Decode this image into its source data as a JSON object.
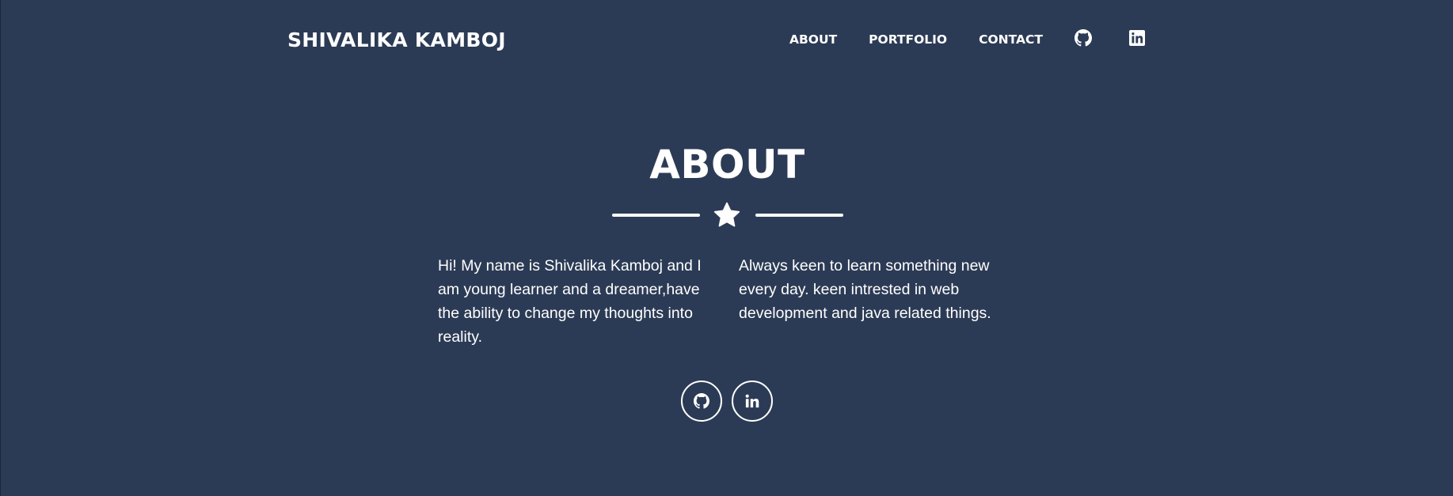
{
  "header": {
    "brand": "SHIVALIKA KAMBOJ",
    "nav": [
      {
        "label": "ABOUT"
      },
      {
        "label": "PORTFOLIO"
      },
      {
        "label": "CONTACT"
      }
    ],
    "icons": [
      "github-icon",
      "linkedin-icon"
    ]
  },
  "about": {
    "title": "ABOUT",
    "divider_icon": "star-icon",
    "paragraph_left": "Hi! My name is Shivalika Kamboj and I am young learner and a dreamer,have the ability to change my thoughts into reality.",
    "paragraph_right": "Always keen to learn something new every day. keen intrested in web development and java related things.",
    "social_icons": [
      "github-icon",
      "linkedin-icon"
    ]
  },
  "colors": {
    "background": "#2c3b55",
    "text": "#ffffff"
  }
}
